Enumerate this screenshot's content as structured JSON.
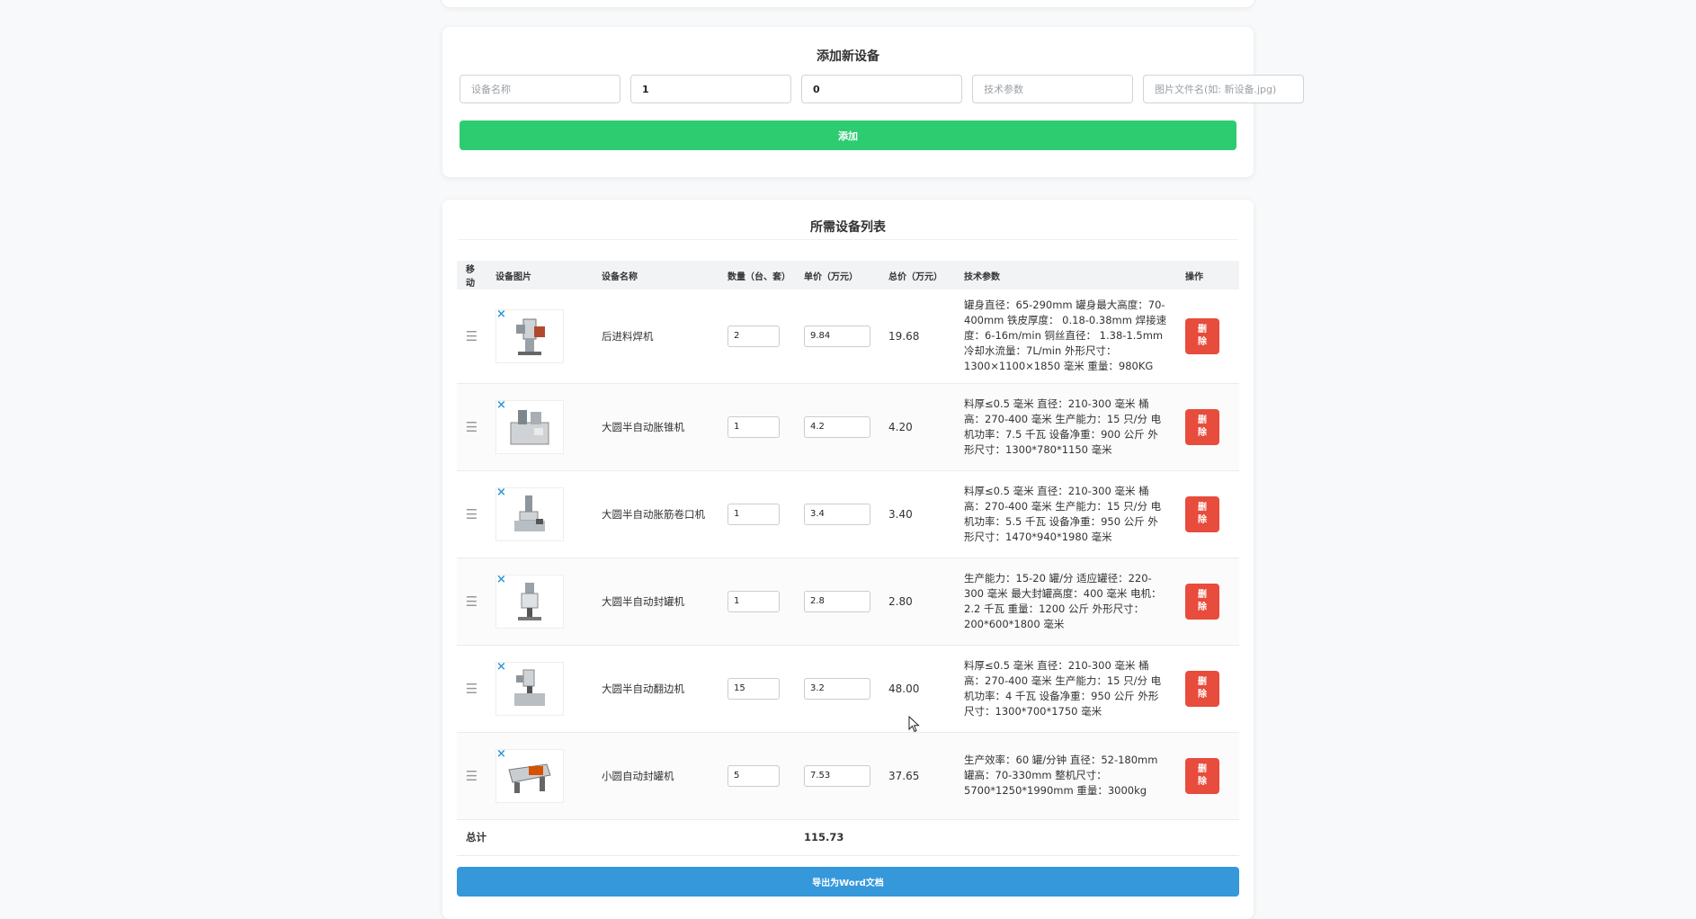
{
  "add_form": {
    "title": "添加新设备",
    "name_placeholder": "设备名称",
    "qty_value": "1",
    "price_value": "0",
    "spec_placeholder": "技术参数",
    "image_placeholder": "图片文件名(如: 新设备.jpg)",
    "add_label": "添加"
  },
  "list": {
    "title": "所需设备列表",
    "headers": {
      "move": "移动",
      "image": "设备图片",
      "name": "设备名称",
      "qty": "数量（台、套）",
      "price": "单价（万元）",
      "total": "总价（万元）",
      "spec": "技术参数",
      "op": "操作"
    },
    "rows": [
      {
        "name": "后进料焊机",
        "qty": "2",
        "price": "9.84",
        "total": "19.68",
        "spec": "罐身直径：65-290mm 罐身最大高度：70-400mm 铁皮厚度： 0.18-0.38mm 焊接速度：6-16m/min 铜丝直径： 1.38-1.5mm 冷却水流量：7L/min 外形尺寸：1300×1100×1850 毫米 重量：980KG",
        "delete": "删\n除",
        "remove_icon": "×",
        "drag_icon": "☰"
      },
      {
        "name": "大圆半自动胀锥机",
        "qty": "1",
        "price": "4.2",
        "total": "4.20",
        "spec": "料厚≤0.5 毫米 直径：210-300 毫米 桶高：270-400 毫米 生产能力：15 只/分 电机功率：7.5 千瓦 设备净重：900 公斤 外形尺寸：1300*780*1150 毫米",
        "delete": "删\n除",
        "remove_icon": "×",
        "drag_icon": "☰"
      },
      {
        "name": "大圆半自动胀筋卷口机",
        "qty": "1",
        "price": "3.4",
        "total": "3.40",
        "spec": "料厚≤0.5 毫米 直径：210-300 毫米 桶高：270-400 毫米 生产能力：15 只/分 电机功率：5.5 千瓦 设备净重：950 公斤 外形尺寸：1470*940*1980 毫米",
        "delete": "删\n除",
        "remove_icon": "×",
        "drag_icon": "☰"
      },
      {
        "name": "大圆半自动封罐机",
        "qty": "1",
        "price": "2.8",
        "total": "2.80",
        "spec": "生产能力：15-20 罐/分 适应罐径：220-300 毫米 最大封罐高度：400 毫米 电机：2.2 千瓦 重量：1200 公斤 外形尺寸：200*600*1800 毫米",
        "delete": "删\n除",
        "remove_icon": "×",
        "drag_icon": "☰"
      },
      {
        "name": "大圆半自动翻边机",
        "qty": "15",
        "price": "3.2",
        "total": "48.00",
        "spec": "料厚≤0.5 毫米 直径：210-300 毫米 桶高：270-400 毫米 生产能力：15 只/分 电机功率：4 千瓦 设备净重：950 公斤 外形尺寸：1300*700*1750 毫米",
        "delete": "删\n除",
        "remove_icon": "×",
        "drag_icon": "☰"
      },
      {
        "name": "小圆自动封罐机",
        "qty": "5",
        "price": "7.53",
        "total": "37.65",
        "spec": "生产效率：60 罐/分钟 直径：52-180mm 罐高：70-330mm 整机尺寸：5700*1250*1990mm 重量：3000kg",
        "delete": "删\n除",
        "remove_icon": "×",
        "drag_icon": "☰"
      }
    ],
    "sum_label": "总计",
    "sum_value": "115.73",
    "export_label": "导出为Word文档"
  },
  "colors": {
    "add_button": "#2ecc71",
    "delete_button": "#e74c3c",
    "export_button": "#3498db",
    "remove_icon": "#3498db"
  }
}
